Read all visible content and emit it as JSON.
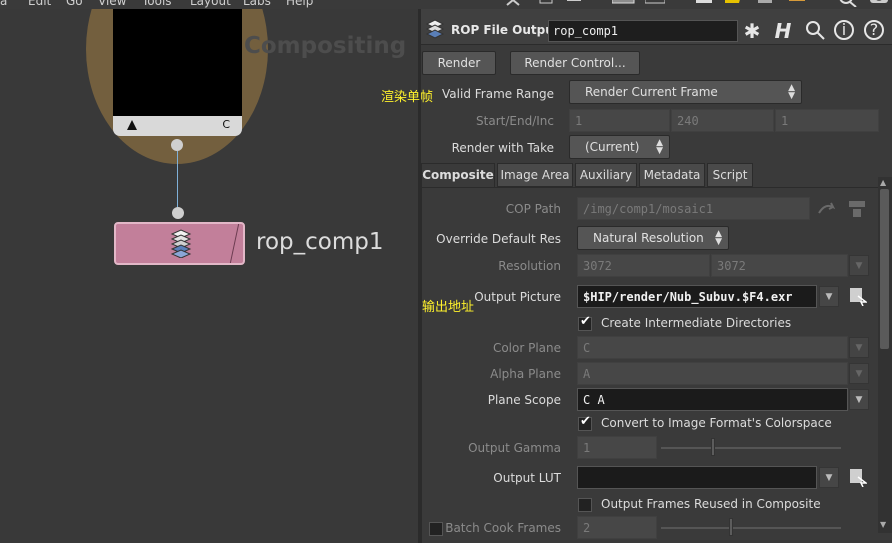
{
  "menubar": {
    "items": [
      "a",
      "Edit",
      "Go",
      "View",
      "Tools",
      "Layout",
      "Labs",
      "Help"
    ]
  },
  "network": {
    "context_label": "Compositing",
    "node1_flag_left": "▲",
    "node1_flag_right": "C",
    "node2_name": "rop_comp1"
  },
  "params": {
    "node_type": "ROP File Output",
    "node_name": "rop_comp1",
    "buttons": {
      "render": "Render",
      "render_control": "Render Control..."
    },
    "valid_frame_range": {
      "label": "Valid Frame Range",
      "value": "Render Current Frame"
    },
    "start_end_inc": {
      "label": "Start/End/Inc",
      "values": [
        "1",
        "240",
        "1"
      ]
    },
    "render_with_take": {
      "label": "Render with Take",
      "value": "(Current)"
    },
    "tabs": [
      "Composite",
      "Image Area",
      "Auxiliary",
      "Metadata",
      "Script"
    ],
    "cop_path": {
      "label": "COP Path",
      "value": "/img/comp1/mosaic1"
    },
    "override_default_res": {
      "label": "Override Default Res",
      "value": "Natural Resolution"
    },
    "resolution": {
      "label": "Resolution",
      "values": [
        "3072",
        "3072"
      ]
    },
    "output_picture": {
      "label": "Output Picture",
      "value": "$HIP/render/Nub_Subuv.$F4.exr"
    },
    "create_intermediate_dirs": {
      "label": "Create Intermediate Directories",
      "checked": true
    },
    "color_plane": {
      "label": "Color Plane",
      "value": "C"
    },
    "alpha_plane": {
      "label": "Alpha Plane",
      "value": "A"
    },
    "plane_scope": {
      "label": "Plane Scope",
      "value": "C A"
    },
    "convert_colorspace": {
      "label": "Convert to Image Format's Colorspace",
      "checked": true
    },
    "output_gamma": {
      "label": "Output Gamma",
      "value": "1"
    },
    "output_lut": {
      "label": "Output LUT",
      "value": ""
    },
    "output_frames_reused": {
      "label": "Output Frames Reused in Composite",
      "checked": false
    },
    "batch_cook_frames": {
      "label": "Batch Cook Frames",
      "value": "2",
      "checked": false
    }
  },
  "annotations": {
    "render_single_frame": "渲染单帧",
    "output_address": "输出地址"
  },
  "colors": {
    "node_pink": "#c27f9a",
    "context_circle": "#735f3e",
    "annotation_yellow": "#fff22b",
    "wire_blue": "#7fb0d8"
  }
}
